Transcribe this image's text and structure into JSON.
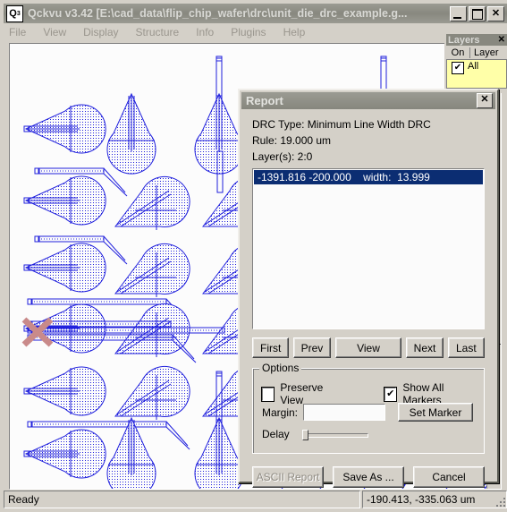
{
  "window": {
    "app_name": "Qckvu v3.42",
    "title": "Qckvu v3.42 [E:\\cad_data\\flip_chip_wafer\\drc\\unit_die_drc_example.g...",
    "icon": "qckvu-app-icon",
    "minimize_label": "",
    "maximize_label": "",
    "close_label": "✕"
  },
  "menu": {
    "items": [
      {
        "label": "File"
      },
      {
        "label": "View"
      },
      {
        "label": "Display"
      },
      {
        "label": "Structure"
      },
      {
        "label": "Info"
      },
      {
        "label": "Plugins"
      },
      {
        "label": "Help"
      }
    ]
  },
  "layers_window": {
    "overlap_title": "Qckvu v3.42 [",
    "title": "Layers",
    "close_label": "✕",
    "columns": [
      "On",
      "Layer"
    ],
    "rows": [
      {
        "on": true,
        "check": "✔",
        "layer": "All"
      }
    ]
  },
  "canvas": {
    "background_color": "#fcfcfc",
    "geometry_color": "#2020dd",
    "marker_color": "#c98a8a",
    "marker_name": "drc-error-x-marker"
  },
  "report_dialog": {
    "title": "Report",
    "close_label": "✕",
    "drc_type": "DRC Type: Minimum Line Width DRC",
    "rule": "Rule: 19.000 um",
    "layers": "Layer(s): 2:0",
    "results": [
      {
        "text": "-1391.816 -200.000    width:  13.999",
        "selected": true
      }
    ],
    "nav": {
      "first": "First",
      "prev": "Prev",
      "view": "View",
      "next": "Next",
      "last": "Last"
    },
    "options": {
      "legend": "Options",
      "preserve_view_label": "Preserve View",
      "preserve_view_checked": false,
      "show_all_markers_label": "Show All Markers",
      "show_all_markers_checked": true,
      "show_all_markers_check": "✔",
      "margin_label": "Margin:",
      "margin_value": "",
      "margin_placeholder": "",
      "set_marker_label": "Set Marker",
      "delay_label": "Delay",
      "delay_value": 0
    },
    "buttons": {
      "ascii_report": "ASCII Report",
      "ascii_report_enabled": false,
      "save_as": "Save As ...",
      "cancel": "Cancel"
    }
  },
  "status_bar": {
    "message": "Ready",
    "coordinates": "-190.413, -335.063 um"
  }
}
